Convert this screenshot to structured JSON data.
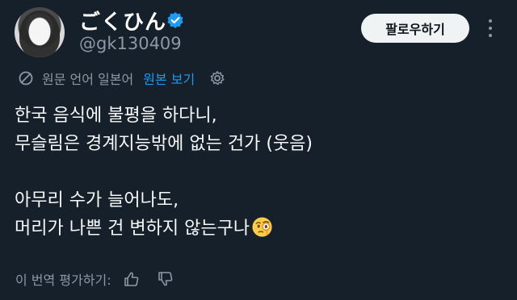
{
  "profile": {
    "display_name": "ごくひん",
    "handle": "@gk130409",
    "verified": true,
    "avatar": "avatar-photo"
  },
  "header": {
    "follow_label": "팔로우하기",
    "more_icon": "more-vertical-icon"
  },
  "translation": {
    "icon": "translate-globe-icon",
    "language_label": "원문 언어 일본어",
    "show_original_label": "원본 보기",
    "settings_icon": "gear-icon"
  },
  "tweet": {
    "lines": [
      "한국 음식에 불평을 하다니,",
      "무슬림은 경계지능밖에 없는 건가 (웃음)",
      "",
      "아무리 수가 늘어나도,",
      "머리가 나쁜 건 변하지 않는구나"
    ],
    "trailing_emoji": "face-with-monocle-emoji"
  },
  "rating": {
    "label": "이 번역 평가하기:",
    "thumbs_up_icon": "thumbs-up-icon",
    "thumbs_down_icon": "thumbs-down-icon"
  },
  "colors": {
    "background": "#15202b",
    "accent": "#1d9bf0",
    "secondary_text": "#8b98a5",
    "follow_button_bg": "#eff3f4"
  }
}
